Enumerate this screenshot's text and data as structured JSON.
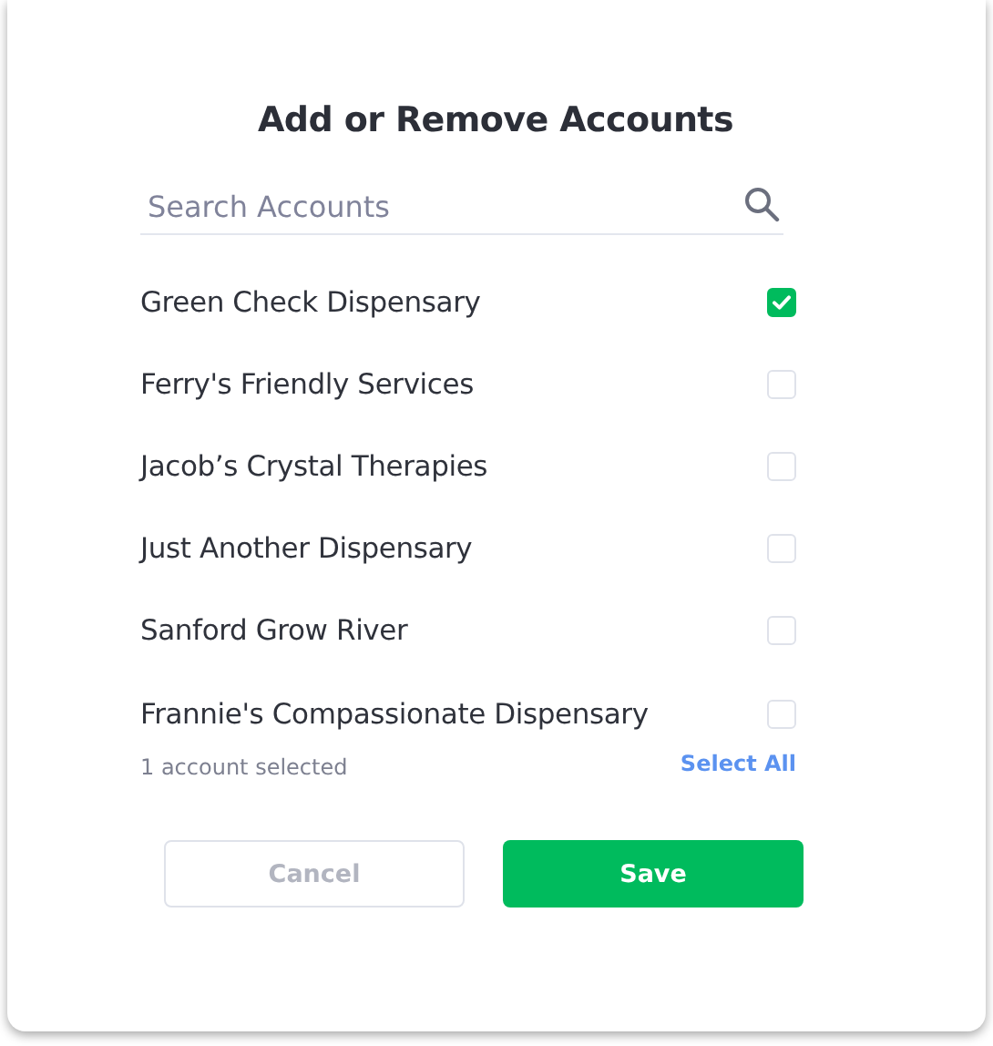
{
  "dialog": {
    "title": "Add or Remove Accounts"
  },
  "search": {
    "placeholder": "Search Accounts"
  },
  "accounts": [
    {
      "name": "Green Check Dispensary",
      "checked": true
    },
    {
      "name": "Ferry's Friendly Services",
      "checked": false
    },
    {
      "name": "Jacob’s Crystal Therapies",
      "checked": false
    },
    {
      "name": "Just Another Dispensary",
      "checked": false
    },
    {
      "name": "Sanford Grow River",
      "checked": false
    },
    {
      "name": "Frannie's Compassionate Dispensary",
      "checked": false
    }
  ],
  "summary": "1 account selected",
  "select_all": "Select All",
  "buttons": {
    "cancel": "Cancel",
    "save": "Save"
  }
}
